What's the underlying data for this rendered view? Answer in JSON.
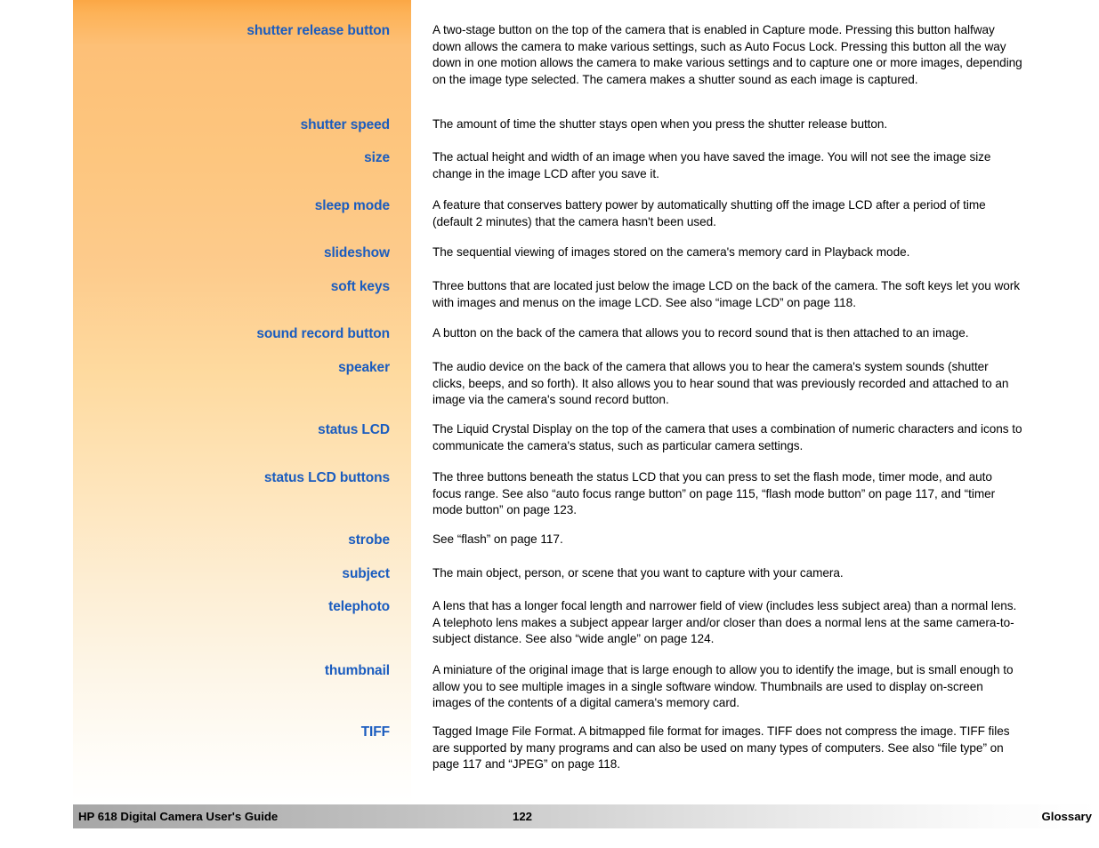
{
  "document": {
    "title": "HP 618 Digital Camera User's Guide",
    "section": "Glossary",
    "page_number": "122"
  },
  "theme": {
    "term_color": "#1a5cbf",
    "band_gradient_top": "#fba745",
    "band_gradient_bottom": "#ffffff",
    "footer_gradient_left": "#a6a6a6",
    "footer_gradient_right": "#ffffff",
    "body_text_color": "#000000",
    "page_background": "#ffffff"
  },
  "glossary": {
    "entries": [
      {
        "term": "shutter release button",
        "definition": "A two-stage button on the top of the camera that is enabled in Capture mode. Pressing this button halfway down allows the camera to make various settings, such as Auto Focus Lock. Pressing this button all the way down in one motion allows the camera to make various settings and to capture one or more images, depending on the image type selected. The camera makes a shutter sound as each image is captured."
      },
      {
        "term": "shutter speed",
        "definition": "The amount of time the shutter stays open when you press the shutter release button."
      },
      {
        "term": "size",
        "definition": "The actual height and width of an image when you have saved the image. You will not see the image size change in the image LCD after you save it."
      },
      {
        "term": "sleep mode",
        "definition": "A feature that conserves battery power by automatically shutting off the image LCD after a period of time (default 2 minutes) that the camera hasn't been used."
      },
      {
        "term": "slideshow",
        "definition": "The sequential viewing of images stored on the camera's memory card in Playback mode."
      },
      {
        "term": "soft keys",
        "definition": "Three buttons that are located just below the image LCD on the back of the camera. The soft keys let you work with images and menus on the image LCD. See also “image LCD” on page 118."
      },
      {
        "term": "sound record button",
        "definition": "A button on the back of the camera that allows you to record sound that is then attached to an image."
      },
      {
        "term": "speaker",
        "definition": "The audio device on the back of the camera that allows you to hear the camera's system sounds (shutter clicks, beeps, and so forth). It also allows you to hear sound that was previously recorded and attached to an image via the camera's sound record button."
      },
      {
        "term": "status LCD",
        "definition": "The Liquid Crystal Display on the top of the camera that uses a combination of numeric characters and icons to communicate the camera's status, such as particular camera settings."
      },
      {
        "term": "status LCD buttons",
        "definition": "The three buttons beneath the status LCD that you can press to set the flash mode, timer mode, and auto focus range. See also “auto focus range button” on page 115, “flash mode button” on page 117, and “timer mode button” on page 123."
      },
      {
        "term": "strobe",
        "definition": "See “flash” on page 117."
      },
      {
        "term": "subject",
        "definition": "The main object, person, or scene that you want to capture with your camera."
      },
      {
        "term": "telephoto",
        "definition": "A lens that has a longer focal length and narrower field of view (includes less subject area) than a normal lens. A telephoto lens makes a subject appear larger and/or closer than does a normal lens at the same camera-to-subject distance. See also “wide angle” on page 124."
      },
      {
        "term": "thumbnail",
        "definition": "A miniature of the original image that is large enough to allow you to identify the image, but is small enough to allow you to see multiple images in a single software window. Thumbnails are used to display on-screen images of the contents of a digital camera's memory card."
      },
      {
        "term": "TIFF",
        "definition": "Tagged Image File Format. A bitmapped file format for images. TIFF does not compress the image. TIFF files are supported by many programs and can also be used on many types of computers. See also “file type” on page 117 and “JPEG” on page 118."
      }
    ]
  },
  "layout": {
    "entry_tops": [
      25,
      131,
      168,
      222,
      275,
      313,
      366,
      404,
      474,
      528,
      598,
      636,
      673,
      745,
      814
    ]
  }
}
